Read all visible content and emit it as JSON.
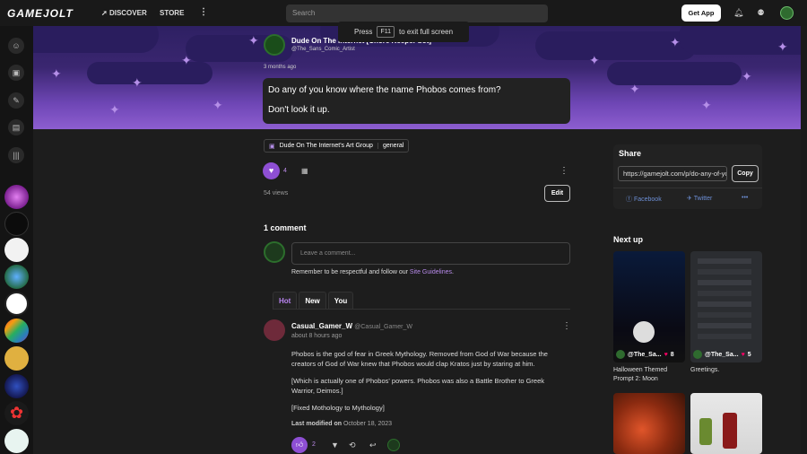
{
  "topbar": {
    "logo": "GAMEJOLT",
    "discover": "DISCOVER",
    "store": "STORE",
    "search_placeholder": "Search",
    "get_app": "Get App"
  },
  "fullscreen_notice": {
    "before": "Press",
    "key": "F11",
    "after": "to exit full screen"
  },
  "post": {
    "author": "Dude On The Internet [Chore Keeper bot]",
    "handle": "@The_Sans_Comic_Artist",
    "time": "3 months ago",
    "lines": [
      "Do any of you know where the name Phobos comes from?",
      "Don't look it up."
    ],
    "group": "Dude On The Internet's Art Group",
    "channel": "general",
    "likes": "4",
    "views": "54 views",
    "edit": "Edit"
  },
  "comments": {
    "title": "1 comment",
    "placeholder": "Leave a comment...",
    "guidelines_before": "Remember to be respectful and follow our",
    "guidelines_link": "Site Guidelines",
    "guidelines_after": ".",
    "tabs": [
      "Hot",
      "New",
      "You"
    ],
    "item": {
      "author": "Casual_Gamer_W",
      "handle": "@Casual_Gamer_W",
      "time": "about 8 hours ago",
      "paras": [
        "Phobos is the god of fear in Greek Mythology. Removed from God of War because the creators of God of War knew that Phobos would clap Kratos just by staring at him.",
        "[Which is actually one of Phobos' powers. Phobos was also a Battle Brother to Greek Warrior, Deimos.]",
        "[Fixed Mothology to Mythology]"
      ],
      "modified_label": "Last modified on",
      "modified_date": "October 18, 2023",
      "likes": "2"
    }
  },
  "share": {
    "title": "Share",
    "url": "https://gamejolt.com/p/do-any-of-you-know",
    "copy": "Copy",
    "facebook": "Facebook",
    "twitter": "Twitter",
    "more": "•••"
  },
  "nextup": {
    "title": "Next up",
    "items": [
      {
        "author": "@The_Sa...",
        "likes": "8",
        "label": "Halloween Themed Prompt 2: Moon"
      },
      {
        "author": "@The_Sa...",
        "likes": "5",
        "label": "Greetings."
      }
    ]
  },
  "colors": {
    "accent": "#8e4fd4",
    "link": "#b78aea",
    "bg": "#1d1d1d"
  }
}
